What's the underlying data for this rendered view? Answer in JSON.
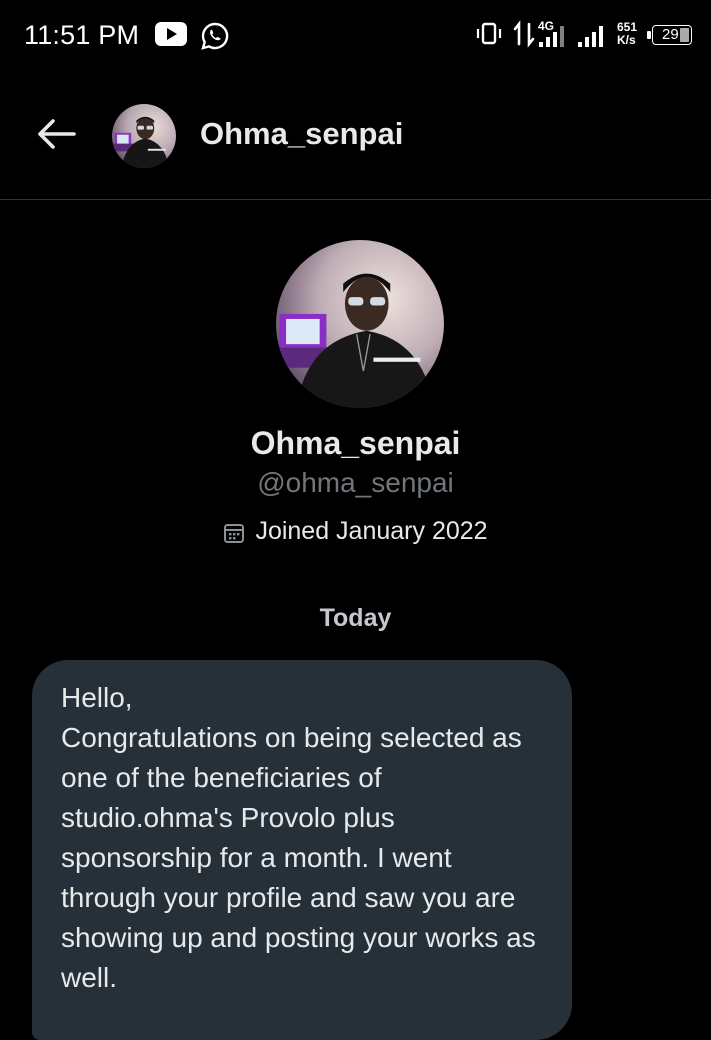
{
  "status_bar": {
    "time": "11:51 PM",
    "network_type": "4G",
    "speed_value": "651",
    "speed_unit": "K/s",
    "battery": "29",
    "icons": [
      "youtube-icon",
      "whatsapp-icon",
      "vibrate-icon",
      "data-transfer-icon",
      "signal-icon"
    ]
  },
  "header": {
    "name": "Ohma_senpai",
    "back_icon": "arrow-left-icon"
  },
  "profile": {
    "display_name": "Ohma_senpai",
    "handle": "@ohma_senpai",
    "joined": "Joined January 2022",
    "joined_icon": "calendar-icon"
  },
  "conversation": {
    "date_label": "Today",
    "messages": [
      {
        "text": "Hello,\nCongratulations on being selected as one of the beneficiaries of studio.ohma's Provolo plus sponsorship for a month. I went through your profile and saw you are showing up and posting your works as well."
      }
    ]
  },
  "colors": {
    "background": "#000000",
    "bubble": "#253038",
    "text_primary": "#e7e9ea",
    "text_secondary": "#71767b",
    "divider": "#2f3336"
  }
}
